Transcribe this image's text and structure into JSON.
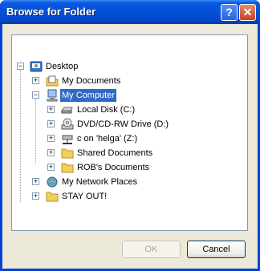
{
  "window": {
    "title": "Browse for Folder"
  },
  "titlebar": {
    "help_glyph": "?",
    "close_glyph": "✕"
  },
  "tree": {
    "items": [
      {
        "label": "Desktop",
        "icon": "desktop-icon",
        "expander": "−"
      },
      {
        "label": "My Documents",
        "icon": "documents-folder-icon",
        "expander": "+"
      },
      {
        "label": "My Computer",
        "icon": "computer-icon",
        "expander": "−",
        "selected": true
      },
      {
        "label": "Local Disk (C:)",
        "icon": "hard-disk-icon",
        "expander": "+"
      },
      {
        "label": "DVD/CD-RW Drive (D:)",
        "icon": "cd-drive-icon",
        "expander": "+"
      },
      {
        "label": "c on 'helga' (Z:)",
        "icon": "network-drive-icon",
        "expander": "+"
      },
      {
        "label": "Shared Documents",
        "icon": "folder-icon",
        "expander": "+"
      },
      {
        "label": "ROB's Documents",
        "icon": "folder-icon",
        "expander": "+"
      },
      {
        "label": "My Network Places",
        "icon": "network-places-icon",
        "expander": "+"
      },
      {
        "label": "STAY OUT!",
        "icon": "folder-icon",
        "expander": "+"
      }
    ]
  },
  "buttons": {
    "ok": "OK",
    "cancel": "Cancel"
  },
  "colors": {
    "selection": "#316ac5",
    "titlebar": "#0550d8",
    "dialog_bg": "#ece9d8",
    "folder": "#f2cf5b"
  }
}
